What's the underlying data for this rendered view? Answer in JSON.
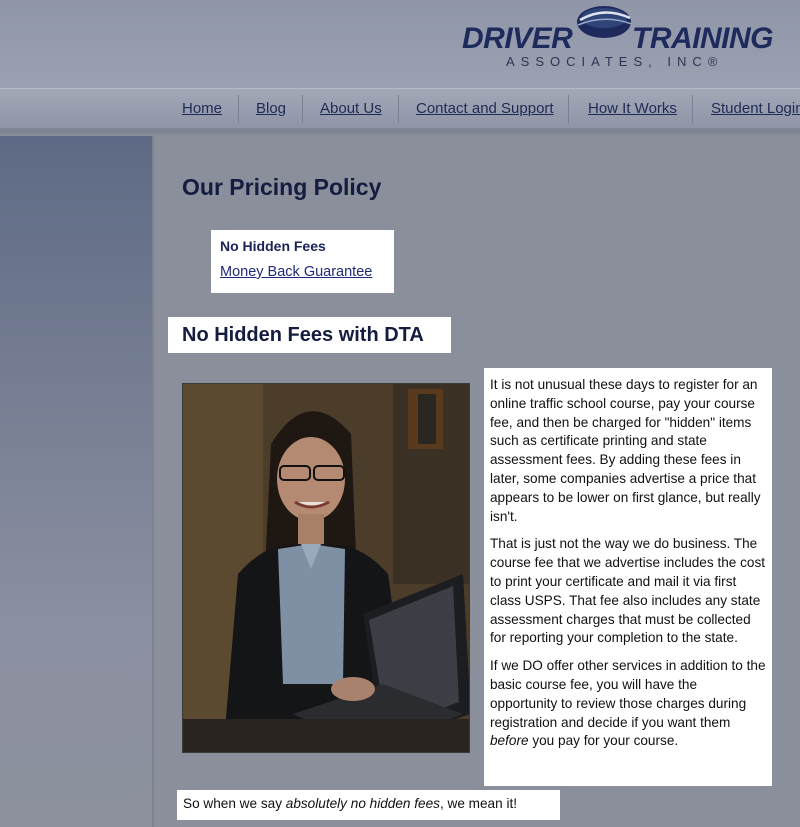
{
  "logo": {
    "word_left": "DRIVER",
    "word_right": "TRAINING",
    "sub": "ASSOCIATES, INC®"
  },
  "nav": {
    "items": [
      "Home",
      "Blog",
      "About Us",
      "Contact and Support",
      "How It Works",
      "Student Login"
    ]
  },
  "main": {
    "page_title": "Our Pricing Policy",
    "toc": {
      "item1": "No Hidden Fees",
      "item2": "Money Back Guarantee"
    },
    "section_title": "No Hidden Fees with DTA",
    "paragraph1": "It is not unusual these days to register for an online traffic school course, pay your course fee, and then be charged for \"hidden\" items such as certificate printing and state assessment fees. By adding these fees in later, some companies advertise a price that appears to be lower on first glance, but really isn't.",
    "paragraph2": "That is just not the way we do business. The course fee that we advertise includes the cost to print your certificate and mail it via first class USPS. That fee also includes any state assessment charges that must be collected for reporting your completion to the state.",
    "paragraph3_a": "If we DO offer other services in addition to the basic course fee, you will have the opportunity to review those charges during registration and decide if you want them ",
    "paragraph3_em": "before",
    "paragraph3_b": " you pay for your course.",
    "closing_a": "So when we say ",
    "closing_em": "absolutely no hidden fees",
    "closing_b": ", we mean it!"
  },
  "colors": {
    "brand_navy": "#1e2a5c",
    "page_bg": "#8a8f9b",
    "link": "#1f2a7a"
  }
}
